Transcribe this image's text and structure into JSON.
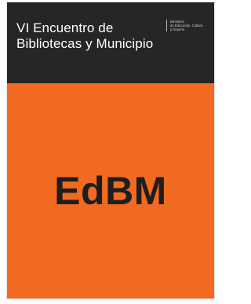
{
  "cover": {
    "title_lines": [
      "VI Encuentro de",
      "Bibliotecas y Municipio"
    ],
    "ministry_lines": [
      "Ministerio",
      "de Educación, Cultura",
      "y Deporte"
    ],
    "logo_text": "EdBM",
    "colors": {
      "header": "#262626",
      "body": "#f26a21",
      "logo": "#1e1e1e",
      "title": "#ffffff"
    }
  }
}
